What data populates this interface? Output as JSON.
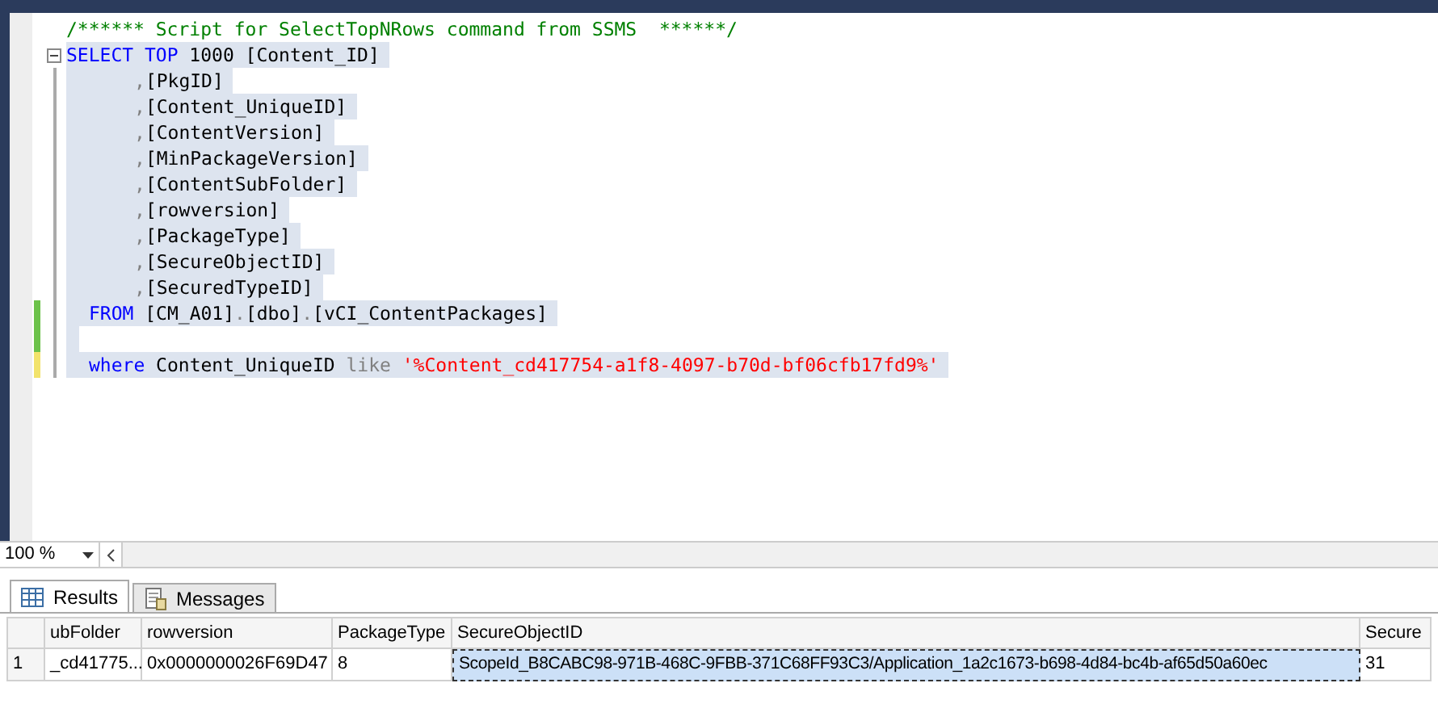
{
  "editor": {
    "lines": [
      {
        "kind": "comment",
        "selected": false,
        "tokens": [
          {
            "kind": "comment",
            "text": "/****** Script for SelectTopNRows command from SSMS  ******/"
          }
        ]
      },
      {
        "kind": "head",
        "collapsible": true,
        "selected": true,
        "tokens": [
          {
            "kind": "keyword",
            "text": "SELECT"
          },
          {
            "kind": "keyword",
            "text": " TOP"
          },
          {
            "kind": "plain",
            "text": " 1000 [Content_ID]"
          }
        ]
      },
      {
        "kind": "column",
        "collapsible": false,
        "selected": true,
        "tokens": [
          {
            "kind": "gray",
            "text": ","
          },
          {
            "kind": "plain",
            "text": "[PkgID]"
          }
        ]
      },
      {
        "kind": "column",
        "collapsible": false,
        "selected": true,
        "tokens": [
          {
            "kind": "gray",
            "text": ","
          },
          {
            "kind": "plain",
            "text": "[Content_UniqueID]"
          }
        ]
      },
      {
        "kind": "column",
        "collapsible": false,
        "selected": true,
        "tokens": [
          {
            "kind": "gray",
            "text": ","
          },
          {
            "kind": "plain",
            "text": "[ContentVersion]"
          }
        ]
      },
      {
        "kind": "column",
        "collapsible": false,
        "selected": true,
        "tokens": [
          {
            "kind": "gray",
            "text": ","
          },
          {
            "kind": "plain",
            "text": "[MinPackageVersion]"
          }
        ]
      },
      {
        "kind": "column",
        "collapsible": false,
        "selected": true,
        "tokens": [
          {
            "kind": "gray",
            "text": ","
          },
          {
            "kind": "plain",
            "text": "[ContentSubFolder]"
          }
        ]
      },
      {
        "kind": "column",
        "collapsible": false,
        "selected": true,
        "tokens": [
          {
            "kind": "gray",
            "text": ","
          },
          {
            "kind": "plain",
            "text": "[rowversion]"
          }
        ]
      },
      {
        "kind": "column",
        "collapsible": false,
        "selected": true,
        "tokens": [
          {
            "kind": "gray",
            "text": ","
          },
          {
            "kind": "plain",
            "text": "[PackageType]"
          }
        ]
      },
      {
        "kind": "column",
        "collapsible": false,
        "selected": true,
        "tokens": [
          {
            "kind": "gray",
            "text": ","
          },
          {
            "kind": "plain",
            "text": "[SecureObjectID]"
          }
        ]
      },
      {
        "kind": "column",
        "collapsible": false,
        "selected": true,
        "tokens": [
          {
            "kind": "gray",
            "text": ","
          },
          {
            "kind": "plain",
            "text": "[SecuredTypeID]"
          }
        ]
      },
      {
        "kind": "clause",
        "collapsible": false,
        "selected": true,
        "color": "#6cc24a",
        "tokens": [
          {
            "kind": "keyword",
            "text": "FROM"
          },
          {
            "kind": "plain",
            "text": " [CM_A01]"
          },
          {
            "kind": "gray",
            "text": "."
          },
          {
            "kind": "plain",
            "text": "[dbo]"
          },
          {
            "kind": "gray",
            "text": "."
          },
          {
            "kind": "plain",
            "text": "[vCI_ContentPackages]"
          }
        ]
      },
      {
        "kind": "blank",
        "collapsible": false,
        "selected": true,
        "color": "#6cc24a"
      },
      {
        "kind": "clause",
        "collapsible": false,
        "selected": true,
        "color": "#f2e36b",
        "tokens": [
          {
            "kind": "keyword",
            "text": "where"
          },
          {
            "kind": "plain",
            "text": " Content_UniqueID"
          },
          {
            "kind": "gray",
            "text": " like"
          },
          {
            "kind": "string",
            "text": " '%Content_cd417754-a1f8-4097-b70d-bf06cfb17fd9%'"
          }
        ]
      }
    ]
  },
  "zoom": {
    "value": "100 %"
  },
  "result_tabs": [
    {
      "label": "Results",
      "selected": true
    },
    {
      "label": "Messages",
      "selected": false
    }
  ],
  "grid": {
    "columns": [
      "ubFolder",
      "rowversion",
      "PackageType",
      "SecureObjectID",
      "Secure"
    ],
    "rows": [
      {
        "number": "1",
        "cells": [
          {
            "text": "_cd41775...",
            "selected": false
          },
          {
            "text": "0x0000000026F69D47",
            "selected": false
          },
          {
            "text": "8",
            "selected": false
          },
          {
            "text": "ScopeId_B8CABC98-971B-468C-9FBB-371C68FF93C3/Application_1a2c1673-b698-4d84-bc4b-af65d50a60ec",
            "selected": true
          },
          {
            "text": "31",
            "selected": false
          }
        ]
      }
    ]
  }
}
